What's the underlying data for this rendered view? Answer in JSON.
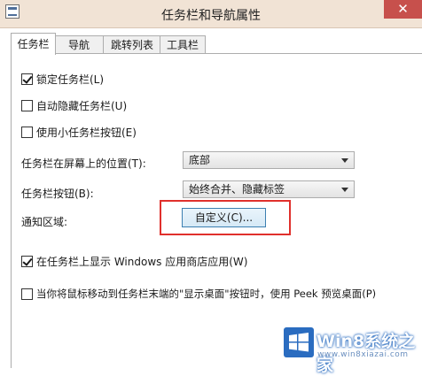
{
  "window": {
    "title": "任务栏和导航属性",
    "close_label": "✕"
  },
  "tabs": [
    {
      "label": "任务栏",
      "active": true
    },
    {
      "label": "导航",
      "active": false
    },
    {
      "label": "跳转列表",
      "active": false
    },
    {
      "label": "工具栏",
      "active": false
    }
  ],
  "options": {
    "lock_taskbar": {
      "label": "锁定任务栏(L)",
      "checked": true
    },
    "auto_hide": {
      "label": "自动隐藏任务栏(U)",
      "checked": false
    },
    "small_buttons": {
      "label": "使用小任务栏按钮(E)",
      "checked": false
    },
    "show_store_apps": {
      "label": "在任务栏上显示 Windows 应用商店应用(W)",
      "checked": true
    },
    "peek_desktop": {
      "label": "当你将鼠标移动到任务栏末端的\"显示桌面\"按钮时，使用 Peek 预览桌面(P)",
      "checked": false
    }
  },
  "location": {
    "label": "任务栏在屏幕上的位置(T):",
    "value": "底部"
  },
  "taskbar_buttons": {
    "label": "任务栏按钮(B):",
    "value": "始终合并、隐藏标签"
  },
  "notification_area": {
    "label": "通知区域:",
    "button_label": "自定义(C)..."
  },
  "watermark": {
    "text": "Win8系统之家",
    "subtext": "www.win8xiazai.com",
    "logo": "windows-logo-icon",
    "highlight_color": "#e0302c"
  }
}
